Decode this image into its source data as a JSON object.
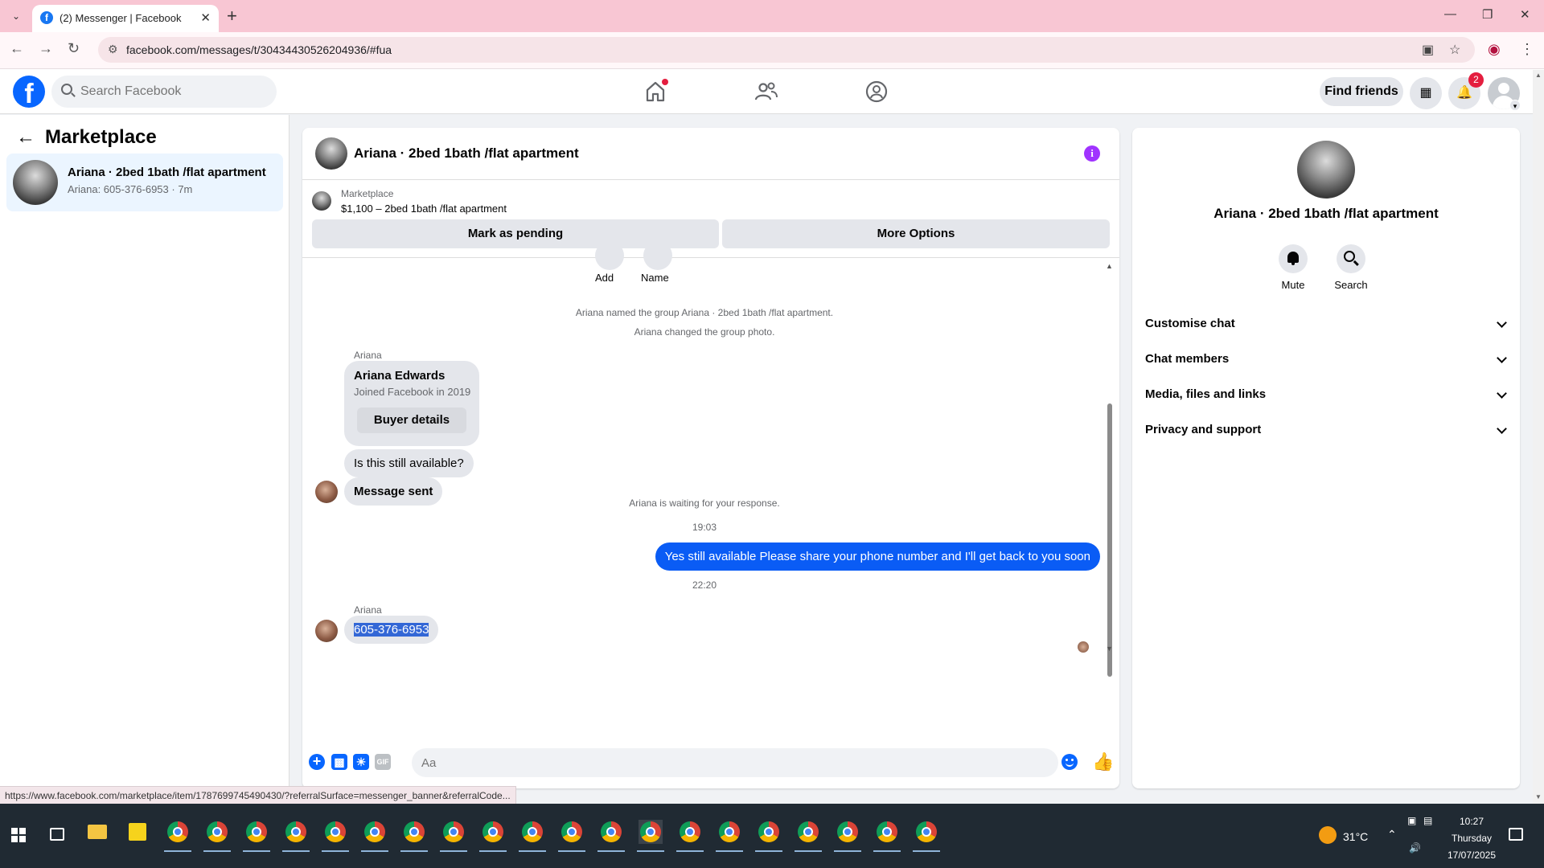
{
  "browser": {
    "tab_title": "(2) Messenger | Facebook",
    "url": "facebook.com/messages/t/30434430526204936/#fua",
    "status_url": "https://www.facebook.com/marketplace/item/1787699745490430/?referralSurface=messenger_banner&referralCode..."
  },
  "fb_header": {
    "search_placeholder": "Search Facebook",
    "find_friends": "Find friends",
    "notification_count": "2"
  },
  "sidebar": {
    "title": "Marketplace",
    "conversation": {
      "name": "Ariana · 2bed 1bath /flat apartment",
      "preview": "Ariana: 605-376-6953 · 7m"
    }
  },
  "chat": {
    "title": "Ariana · 2bed 1bath /flat apartment",
    "marketplace_label": "Marketplace",
    "listing": "$1,100 – 2bed 1bath /flat apartment",
    "mark_pending": "Mark as pending",
    "more_options": "More Options",
    "add_label": "Add",
    "name_label": "Name",
    "system_named": "Ariana named the group Ariana · 2bed 1bath /flat apartment.",
    "system_photo": "Ariana changed the group photo.",
    "sender": "Ariana",
    "card_name": "Ariana Edwards",
    "card_joined": "Joined Facebook in 2019",
    "card_button": "Buyer details",
    "msg_available": "Is this still available?",
    "msg_sent": "Message sent",
    "waiting": "Ariana is waiting for your response.",
    "time_1": "19:03",
    "outgoing": "Yes still available Please share your phone number and I'll get back to you soon",
    "time_2": "22:20",
    "sender_2": "Ariana",
    "phone": "605-376-6953",
    "composer_placeholder": "Aa"
  },
  "info_panel": {
    "name": "Ariana · 2bed 1bath /flat apartment",
    "mute": "Mute",
    "search": "Search",
    "sections": [
      "Customise chat",
      "Chat members",
      "Media, files and links",
      "Privacy and support"
    ]
  },
  "taskbar": {
    "temperature": "31°C",
    "time": "10:27",
    "day": "Thursday",
    "date": "17/07/2025"
  },
  "colors": {
    "facebook_blue": "#0866ff",
    "outgoing_bubble": "#0a5cf5",
    "info_icon": "#a033ff",
    "tab_strip": "#f8c6d3"
  }
}
